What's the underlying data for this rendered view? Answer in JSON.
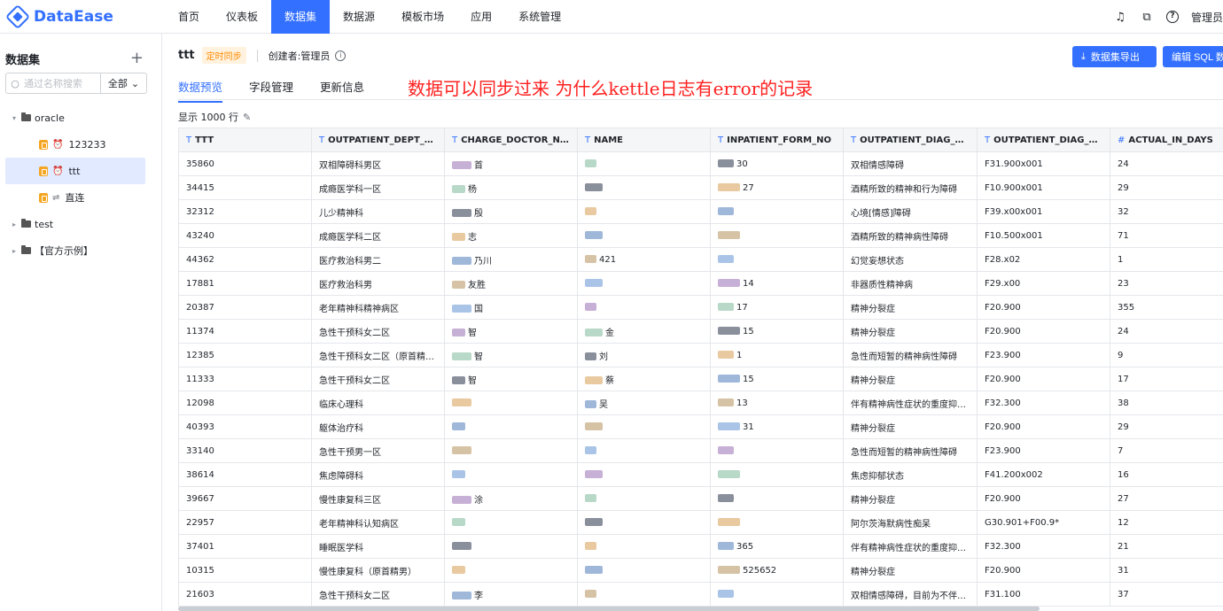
{
  "app": {
    "logo": "DataEase"
  },
  "nav": [
    {
      "label": "首页"
    },
    {
      "label": "仪表板"
    },
    {
      "label": "数据集",
      "active": true
    },
    {
      "label": "数据源"
    },
    {
      "label": "模板市场"
    },
    {
      "label": "应用"
    },
    {
      "label": "系统管理"
    }
  ],
  "topright": {
    "user": "管理员"
  },
  "sidebar": {
    "title": "数据集",
    "search_placeholder": "通过名称搜索",
    "filter": "全部",
    "tree": [
      {
        "label": "oracle",
        "type": "folder",
        "expanded": true
      },
      {
        "label": "123233",
        "type": "dataset",
        "sync": "timer"
      },
      {
        "label": "ttt",
        "type": "dataset",
        "sync": "timer",
        "selected": true
      },
      {
        "label": "直连",
        "type": "dataset",
        "sync": "direct"
      },
      {
        "label": "test",
        "type": "folder",
        "expanded": false
      },
      {
        "label": "【官方示例】",
        "type": "folder",
        "expanded": false
      }
    ]
  },
  "dataset": {
    "name": "ttt",
    "tag": "定时同步",
    "creator": "创建者:管理员",
    "export_button": "数据集导出",
    "edit_sql_button": "编辑 SQL 数",
    "tabs": [
      {
        "label": "数据预览",
        "active": true
      },
      {
        "label": "字段管理"
      },
      {
        "label": "更新信息"
      }
    ],
    "row_count": "显示 1000 行"
  },
  "annotation": "数据可以同步过来  为什么kettle日志有error的记录",
  "table": {
    "columns": [
      {
        "type": "T",
        "name": "TTT"
      },
      {
        "type": "T",
        "name": "OUTPATIENT_DEPT_CN"
      },
      {
        "type": "T",
        "name": "CHARGE_DOCTOR_NAME"
      },
      {
        "type": "T",
        "name": "NAME"
      },
      {
        "type": "T",
        "name": "INPATIENT_FORM_NO"
      },
      {
        "type": "T",
        "name": "OUTPATIENT_DIAG_NAME"
      },
      {
        "type": "T",
        "name": "OUTPATIENT_DIAG_CODE"
      },
      {
        "type": "#",
        "name": "ACTUAL_IN_DAYS"
      }
    ],
    "rows": [
      [
        "35860",
        "双相障碍科男区",
        "首",
        "",
        "30",
        "双相情感障碍",
        "F31.900x001",
        "24"
      ],
      [
        "34415",
        "成瘾医学科一区",
        "杨",
        "",
        "27",
        "酒精所致的精神和行为障碍",
        "F10.900x001",
        "29"
      ],
      [
        "32312",
        "儿少精神科",
        "殷",
        "",
        "",
        "心境[情感]障碍",
        "F39.x00x001",
        "32"
      ],
      [
        "43240",
        "成瘾医学科二区",
        "志",
        "",
        "",
        "酒精所致的精神病性障碍",
        "F10.500x001",
        "71"
      ],
      [
        "44362",
        "医疗救治科男二",
        "乃川",
        "421",
        "",
        "幻觉妄想状态",
        "F28.x02",
        "1"
      ],
      [
        "17881",
        "医疗救治科男",
        "友胜",
        "",
        "14",
        "非器质性精神病",
        "F29.x00",
        "23"
      ],
      [
        "20387",
        "老年精神科精神病区",
        "国",
        "",
        "17",
        "精神分裂症",
        "F20.900",
        "355"
      ],
      [
        "11374",
        "急性干预科女二区",
        "智",
        "金",
        "15",
        "精神分裂症",
        "F20.900",
        "24"
      ],
      [
        "12385",
        "急性干预科女二区（原首精女）",
        "智",
        "刘",
        "1",
        "急性而短暂的精神病性障碍",
        "F23.900",
        "9"
      ],
      [
        "11333",
        "急性干预科女二区",
        "智",
        "蔡",
        "15",
        "精神分裂症",
        "F20.900",
        "17"
      ],
      [
        "12098",
        "临床心理科",
        "",
        "吴",
        "13",
        "伴有精神病性症状的重度抑郁发作",
        "F32.300",
        "38"
      ],
      [
        "40393",
        "躯体治疗科",
        "",
        "",
        "31",
        "精神分裂症",
        "F20.900",
        "29"
      ],
      [
        "33140",
        "急性干预男一区",
        "",
        "",
        "",
        "急性而短暂的精神病性障碍",
        "F23.900",
        "7"
      ],
      [
        "38614",
        "焦虑障碍科",
        "",
        "",
        "",
        "焦虑抑郁状态",
        "F41.200x002",
        "16"
      ],
      [
        "39667",
        "慢性康复科三区",
        "涂",
        "",
        "",
        "精神分裂症",
        "F20.900",
        "27"
      ],
      [
        "22957",
        "老年精神科认知病区",
        "",
        "",
        "",
        "阿尔茨海默病性痴呆",
        "G30.901+F00.9*",
        "12"
      ],
      [
        "37401",
        "睡眠医学科",
        "",
        "",
        "365",
        "伴有精神病性症状的重度抑郁发作",
        "F32.300",
        "21"
      ],
      [
        "10315",
        "慢性康复科（原首精男）",
        "",
        "",
        "525652",
        "精神分裂症",
        "F20.900",
        "31"
      ],
      [
        "21603",
        "急性干预科女二区",
        "李",
        "",
        "",
        "双相情感障碍，目前为不伴有精神病性症状",
        "F31.100",
        "37"
      ]
    ]
  },
  "colors": {
    "accent": "#3370ff",
    "annotation": "#ff2020",
    "tag_bg": "#fff3e0",
    "tag_fg": "#ff8800"
  }
}
